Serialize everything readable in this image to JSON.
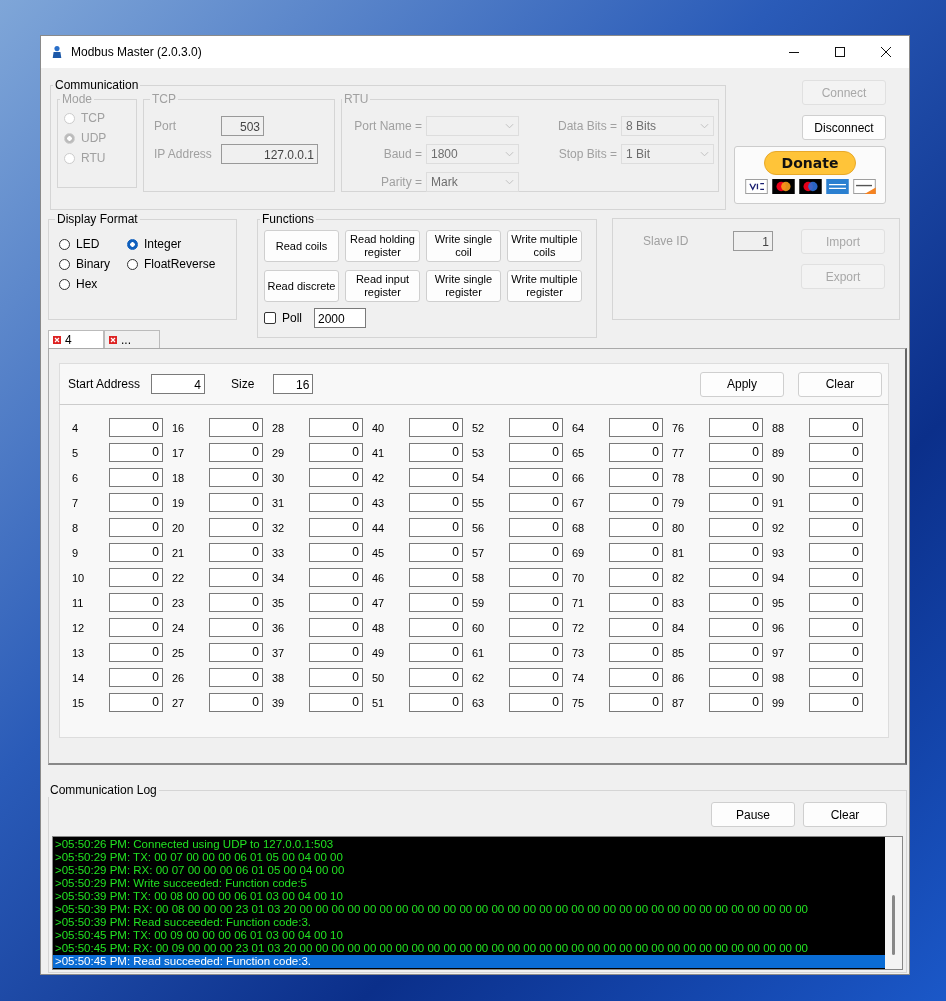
{
  "window": {
    "title": "Modbus Master (2.0.3.0)"
  },
  "communication": {
    "title": "Communication",
    "disabled": true,
    "mode": {
      "title": "Mode",
      "options": [
        {
          "label": "TCP",
          "selected": false
        },
        {
          "label": "UDP",
          "selected": true
        },
        {
          "label": "RTU",
          "selected": false
        }
      ]
    },
    "tcp": {
      "title": "TCP",
      "fields": [
        {
          "label": "Port",
          "value": "503"
        },
        {
          "label": "IP Address",
          "value": "127.0.0.1"
        }
      ]
    },
    "rtu": {
      "title": "RTU",
      "fields": [
        {
          "label": "Port Name ="
        },
        {
          "label": "Baud =",
          "value": "1800"
        },
        {
          "label": "Parity =",
          "value": "Mark"
        },
        {
          "label": "Data Bits =",
          "value": "8 Bits"
        },
        {
          "label": "Stop Bits =",
          "value": "1 Bit"
        }
      ]
    }
  },
  "connection_buttons": [
    {
      "label": "Connect",
      "disabled": true
    },
    {
      "label": "Disconnect",
      "disabled": false
    }
  ],
  "donate": {
    "label": "Donate"
  },
  "display_format": {
    "title": "Display Format",
    "options": [
      {
        "label": "LED",
        "selected": false
      },
      {
        "label": "Binary",
        "selected": false
      },
      {
        "label": "Hex",
        "selected": false
      },
      {
        "label": "Integer",
        "selected": true
      },
      {
        "label": "FloatReverse",
        "selected": false
      }
    ]
  },
  "functions": {
    "title": "Functions",
    "buttons": [
      "Read coils",
      "Read holding register",
      "Write single coil",
      "Write multiple coils",
      "Read discrete",
      "Read input register",
      "Write single register",
      "Write multiple register"
    ],
    "poll": {
      "label": "Poll",
      "checked": false,
      "value": "2000"
    }
  },
  "slave": {
    "label": "Slave ID",
    "value": "1",
    "disabled": true,
    "buttons": [
      {
        "label": "Import",
        "disabled": true
      },
      {
        "label": "Export",
        "disabled": true
      }
    ]
  },
  "tabs": [
    {
      "label": "4",
      "selected": true
    },
    {
      "label": "...",
      "selected": false
    }
  ],
  "register_panel": {
    "start_address": {
      "label": "Start Address",
      "value": "4"
    },
    "size": {
      "label": "Size",
      "value": "16"
    },
    "buttons": [
      "Apply",
      "Clear"
    ],
    "registers": [
      {
        "address": "4",
        "value": "0"
      },
      {
        "address": "5",
        "value": "0"
      },
      {
        "address": "6",
        "value": "0"
      },
      {
        "address": "7",
        "value": "0"
      },
      {
        "address": "8",
        "value": "0"
      },
      {
        "address": "9",
        "value": "0"
      },
      {
        "address": "10",
        "value": "0"
      },
      {
        "address": "11",
        "value": "0"
      },
      {
        "address": "12",
        "value": "0"
      },
      {
        "address": "13",
        "value": "0"
      },
      {
        "address": "14",
        "value": "0"
      },
      {
        "address": "15",
        "value": "0"
      },
      {
        "address": "16",
        "value": "0"
      },
      {
        "address": "17",
        "value": "0"
      },
      {
        "address": "18",
        "value": "0"
      },
      {
        "address": "19",
        "value": "0"
      },
      {
        "address": "20",
        "value": "0"
      },
      {
        "address": "21",
        "value": "0"
      },
      {
        "address": "22",
        "value": "0"
      },
      {
        "address": "23",
        "value": "0"
      },
      {
        "address": "24",
        "value": "0"
      },
      {
        "address": "25",
        "value": "0"
      },
      {
        "address": "26",
        "value": "0"
      },
      {
        "address": "27",
        "value": "0"
      },
      {
        "address": "28",
        "value": "0"
      },
      {
        "address": "29",
        "value": "0"
      },
      {
        "address": "30",
        "value": "0"
      },
      {
        "address": "31",
        "value": "0"
      },
      {
        "address": "32",
        "value": "0"
      },
      {
        "address": "33",
        "value": "0"
      },
      {
        "address": "34",
        "value": "0"
      },
      {
        "address": "35",
        "value": "0"
      },
      {
        "address": "36",
        "value": "0"
      },
      {
        "address": "37",
        "value": "0"
      },
      {
        "address": "38",
        "value": "0"
      },
      {
        "address": "39",
        "value": "0"
      },
      {
        "address": "40",
        "value": "0"
      },
      {
        "address": "41",
        "value": "0"
      },
      {
        "address": "42",
        "value": "0"
      },
      {
        "address": "43",
        "value": "0"
      },
      {
        "address": "44",
        "value": "0"
      },
      {
        "address": "45",
        "value": "0"
      },
      {
        "address": "46",
        "value": "0"
      },
      {
        "address": "47",
        "value": "0"
      },
      {
        "address": "48",
        "value": "0"
      },
      {
        "address": "49",
        "value": "0"
      },
      {
        "address": "50",
        "value": "0"
      },
      {
        "address": "51",
        "value": "0"
      },
      {
        "address": "52",
        "value": "0"
      },
      {
        "address": "53",
        "value": "0"
      },
      {
        "address": "54",
        "value": "0"
      },
      {
        "address": "55",
        "value": "0"
      },
      {
        "address": "56",
        "value": "0"
      },
      {
        "address": "57",
        "value": "0"
      },
      {
        "address": "58",
        "value": "0"
      },
      {
        "address": "59",
        "value": "0"
      },
      {
        "address": "60",
        "value": "0"
      },
      {
        "address": "61",
        "value": "0"
      },
      {
        "address": "62",
        "value": "0"
      },
      {
        "address": "63",
        "value": "0"
      },
      {
        "address": "64",
        "value": "0"
      },
      {
        "address": "65",
        "value": "0"
      },
      {
        "address": "66",
        "value": "0"
      },
      {
        "address": "67",
        "value": "0"
      },
      {
        "address": "68",
        "value": "0"
      },
      {
        "address": "69",
        "value": "0"
      },
      {
        "address": "70",
        "value": "0"
      },
      {
        "address": "71",
        "value": "0"
      },
      {
        "address": "72",
        "value": "0"
      },
      {
        "address": "73",
        "value": "0"
      },
      {
        "address": "74",
        "value": "0"
      },
      {
        "address": "75",
        "value": "0"
      },
      {
        "address": "76",
        "value": "0"
      },
      {
        "address": "77",
        "value": "0"
      },
      {
        "address": "78",
        "value": "0"
      },
      {
        "address": "79",
        "value": "0"
      },
      {
        "address": "80",
        "value": "0"
      },
      {
        "address": "81",
        "value": "0"
      },
      {
        "address": "82",
        "value": "0"
      },
      {
        "address": "83",
        "value": "0"
      },
      {
        "address": "84",
        "value": "0"
      },
      {
        "address": "85",
        "value": "0"
      },
      {
        "address": "86",
        "value": "0"
      },
      {
        "address": "87",
        "value": "0"
      },
      {
        "address": "88",
        "value": "0"
      },
      {
        "address": "89",
        "value": "0"
      },
      {
        "address": "90",
        "value": "0"
      },
      {
        "address": "91",
        "value": "0"
      },
      {
        "address": "92",
        "value": "0"
      },
      {
        "address": "93",
        "value": "0"
      },
      {
        "address": "94",
        "value": "0"
      },
      {
        "address": "95",
        "value": "0"
      },
      {
        "address": "96",
        "value": "0"
      },
      {
        "address": "97",
        "value": "0"
      },
      {
        "address": "98",
        "value": "0"
      },
      {
        "address": "99",
        "value": "0"
      }
    ]
  },
  "communication_log": {
    "title": "Communication Log",
    "buttons": [
      "Pause",
      "Clear"
    ],
    "entries": [
      {
        "text": ">05:50:26 PM: Connected using UDP to 127.0.0.1:503",
        "selected": false
      },
      {
        "text": ">05:50:29 PM: TX: 00 07 00 00 00 06 01 05 00 04 00 00",
        "selected": false
      },
      {
        "text": ">05:50:29 PM: RX: 00 07 00 00 00 06 01 05 00 04 00 00",
        "selected": false
      },
      {
        "text": ">05:50:29 PM: Write succeeded: Function code:5",
        "selected": false
      },
      {
        "text": ">05:50:39 PM: TX: 00 08 00 00 00 06 01 03 00 04 00 10",
        "selected": false
      },
      {
        "text": ">05:50:39 PM: RX: 00 08 00 00 00 23 01 03 20 00 00 00 00 00 00 00 00 00 00 00 00 00 00 00 00 00 00 00 00 00 00 00 00 00 00 00 00 00 00 00 00",
        "selected": false
      },
      {
        "text": ">05:50:39 PM: Read succeeded: Function code:3.",
        "selected": false
      },
      {
        "text": ">05:50:45 PM: TX: 00 09 00 00 00 06 01 03 00 04 00 10",
        "selected": false
      },
      {
        "text": ">05:50:45 PM: RX: 00 09 00 00 00 23 01 03 20 00 00 00 00 00 00 00 00 00 00 00 00 00 00 00 00 00 00 00 00 00 00 00 00 00 00 00 00 00 00 00 00",
        "selected": false
      },
      {
        "text": ">05:50:45 PM: Read succeeded: Function code:3.",
        "selected": true
      }
    ]
  }
}
